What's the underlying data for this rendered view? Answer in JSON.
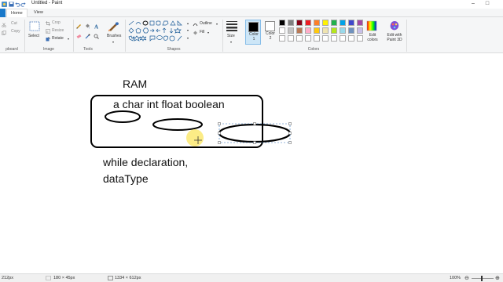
{
  "window": {
    "title": "Untitled - Paint",
    "minimize": "–",
    "maximize": "□"
  },
  "tabs": [
    {
      "label": "Home"
    },
    {
      "label": "View"
    }
  ],
  "clipboard": {
    "group_label": "pboard",
    "cut": "Cut",
    "copy": "Copy"
  },
  "image": {
    "group_label": "Image",
    "select": "Select",
    "crop": "Crop",
    "resize": "Resize",
    "rotate": "Rotate"
  },
  "tools": {
    "group_label": "Tools"
  },
  "brushes": {
    "label": "Brushes"
  },
  "shapes": {
    "group_label": "Shapes",
    "outline": "Outline",
    "fill": "Fill"
  },
  "size": {
    "label": "Size"
  },
  "colors": {
    "group_label": "Colors",
    "color1_line1": "Color",
    "color1_line2": "1",
    "color2_line1": "Color",
    "color2_line2": "2",
    "edit_colors_line1": "Edit",
    "edit_colors_line2": "colors",
    "edit_p3d_line1": "Edit with",
    "edit_p3d_line2": "Paint 3D",
    "palette_row1": [
      "#000000",
      "#7f7f7f",
      "#880015",
      "#ed1c24",
      "#ff7f27",
      "#fff200",
      "#22b14c",
      "#00a2e8",
      "#3f48cc",
      "#a349a4"
    ],
    "palette_row2": [
      "#ffffff",
      "#c3c3c3",
      "#b97a57",
      "#ffaec9",
      "#ffc90e",
      "#efe4b0",
      "#b5e61d",
      "#99d9ea",
      "#7092be",
      "#c8bfe7"
    ],
    "palette_row3": [
      "#ffffff",
      "#ffffff",
      "#ffffff",
      "#ffffff",
      "#ffffff",
      "#ffffff",
      "#ffffff",
      "#ffffff",
      "#ffffff",
      "#ffffff"
    ]
  },
  "canvas": {
    "ram_label": "RAM",
    "types_label": "a  char int float boolean",
    "line1": "while declaration,",
    "line2": "dataType"
  },
  "status": {
    "position": "212px",
    "selection_size": "180 × 45px",
    "image_size": "1334 × 612px",
    "zoom": "100%"
  }
}
